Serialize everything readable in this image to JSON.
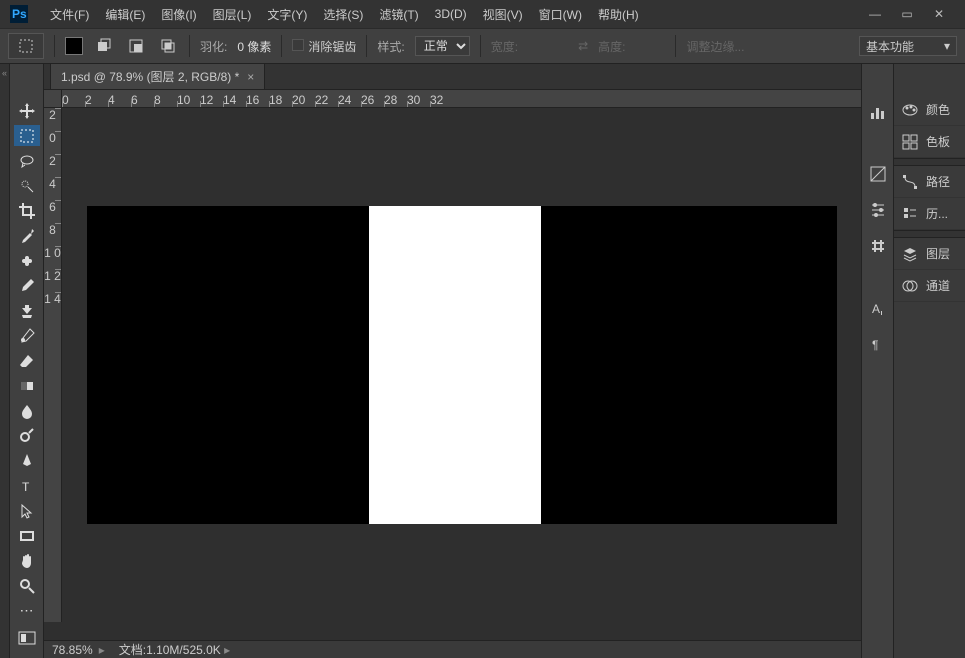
{
  "menu": {
    "items": [
      "文件(F)",
      "编辑(E)",
      "图像(I)",
      "图层(L)",
      "文字(Y)",
      "选择(S)",
      "滤镜(T)",
      "3D(D)",
      "视图(V)",
      "窗口(W)",
      "帮助(H)"
    ]
  },
  "options": {
    "feather_label": "羽化:",
    "feather_value": "0 像素",
    "antialias_label": "消除锯齿",
    "style_label": "样式:",
    "style_value": "正常",
    "width_label": "宽度:",
    "height_label": "高度:",
    "refine_label": "调整边缘...",
    "workspace": "基本功能"
  },
  "document": {
    "tab_title": "1.psd @ 78.9% (图层 2, RGB/8) *"
  },
  "status": {
    "zoom": "78.85%",
    "doc_label": "文档:",
    "doc_value": "1.10M/525.0K"
  },
  "ruler_h": [
    "0",
    "2",
    "4",
    "6",
    "8",
    "10",
    "12",
    "14",
    "16",
    "18",
    "20",
    "22",
    "24",
    "26",
    "28",
    "30",
    "32"
  ],
  "ruler_v": [
    "2",
    "0",
    "2",
    "4",
    "6",
    "8",
    "1\n0",
    "1\n2",
    "1\n4"
  ],
  "rightpanel": {
    "items": [
      "颜色",
      "色板",
      "路径",
      "历...",
      "图层",
      "通道"
    ]
  }
}
